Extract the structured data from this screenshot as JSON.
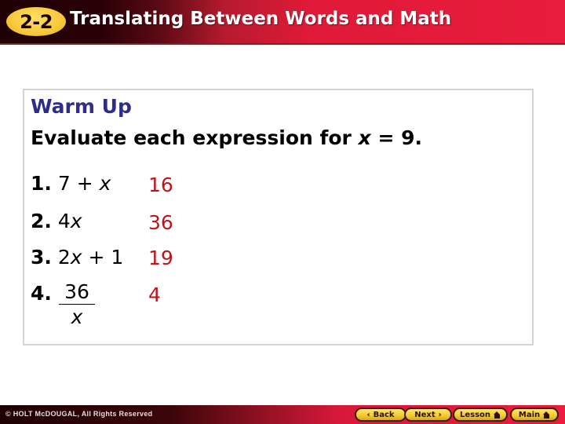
{
  "header": {
    "lesson_number": "2-2",
    "title": "Translating Between Words and Math"
  },
  "warmup": {
    "heading": "Warm Up",
    "instruction_prefix": "Evaluate each expression for ",
    "instruction_var": "x",
    "instruction_suffix": " = 9.",
    "problems": [
      {
        "num": "1.",
        "expr_a": "7 + ",
        "expr_var": "x",
        "expr_b": "",
        "answer": "16"
      },
      {
        "num": "2.",
        "expr_a": "4",
        "expr_var": "x",
        "expr_b": "",
        "answer": "36"
      },
      {
        "num": "3.",
        "expr_a": "2",
        "expr_var": "x",
        "expr_b": " + 1",
        "answer": "19"
      },
      {
        "num": "4.",
        "numerator": "36",
        "denominator": "x",
        "answer": "4"
      }
    ]
  },
  "footer": {
    "copyright": "© HOLT McDOUGAL, All Rights Reserved",
    "nav": {
      "back": "Back",
      "next": "Next",
      "lesson": "Lesson",
      "main": "Main"
    }
  },
  "colors": {
    "heading": "#2e2e8a",
    "answer": "#c0141c",
    "badge": "#f7c83a",
    "header_red": "#e81c3c"
  }
}
